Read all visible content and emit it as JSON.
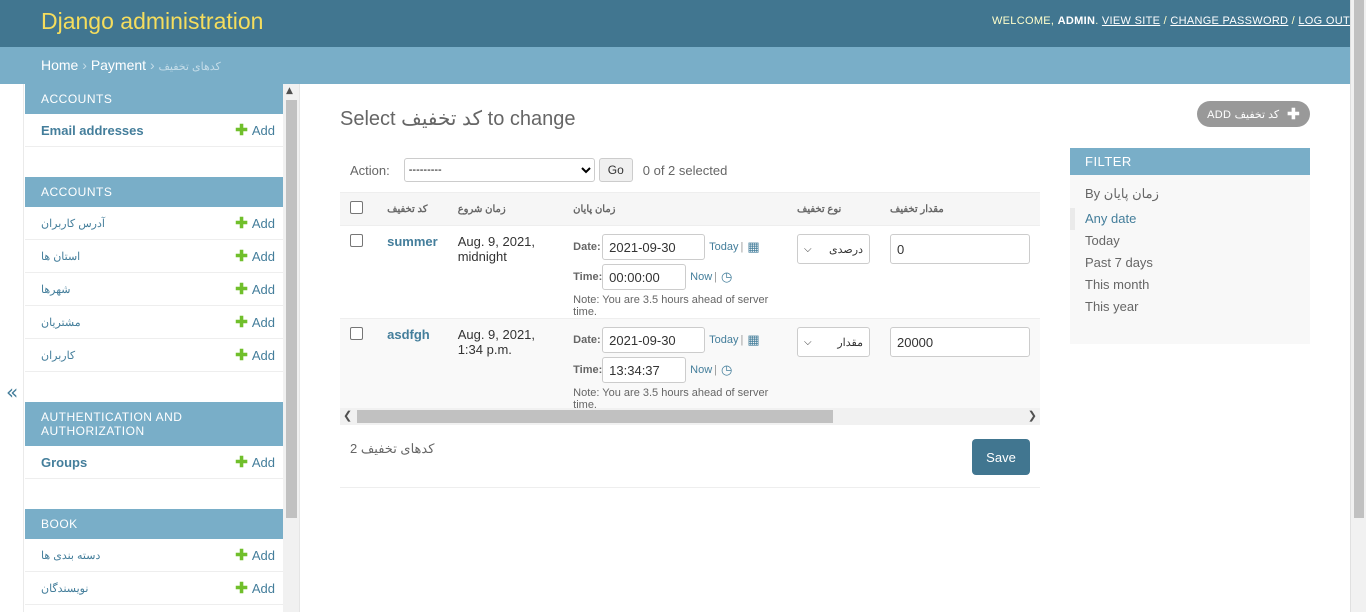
{
  "header": {
    "brand": "Django administration",
    "welcome": "WELCOME,",
    "user": "ADMIN",
    "dot": ".",
    "view_site": "VIEW SITE",
    "sep": "/",
    "change_password": "CHANGE PASSWORD",
    "log_out": "LOG OUT"
  },
  "breadcrumbs": {
    "home": "Home",
    "sep": "›",
    "app": "Payment",
    "current": "کدهای تخفیف"
  },
  "sidebar": {
    "toggle": "«",
    "add_label": "Add",
    "modules": [
      {
        "caption": "ACCOUNTS",
        "items": [
          "Email addresses"
        ]
      },
      {
        "caption": "ACCOUNTS",
        "items": [
          "آدرس کاربران",
          "استان ها",
          "شهرها",
          "مشتریان",
          "کاربران"
        ]
      },
      {
        "caption": "AUTHENTICATION AND AUTHORIZATION",
        "items": [
          "Groups"
        ]
      },
      {
        "caption": "BOOK",
        "items": [
          "دسته بندی ها",
          "نویسندگان"
        ]
      }
    ]
  },
  "content": {
    "title": "Select کد تخفیف to change",
    "add_button": "ADD کد تخفیف",
    "action_label": "Action:",
    "action_select": "---------",
    "go": "Go",
    "selected": "0 of 2 selected",
    "columns": [
      "کد تخفیف",
      "زمان شروع",
      "زمان پایان",
      "نوع تخفیف",
      "مقدار تخفیف"
    ],
    "date_label": "Date:",
    "time_label": "Time:",
    "today": "Today",
    "now": "Now",
    "pipe": "|",
    "help": "Note: You are 3.5 hours ahead of server time.",
    "rows": [
      {
        "code": "summer",
        "start": "Aug. 9, 2021, midnight",
        "date": "2021-09-30",
        "time": "00:00:00",
        "type": "درصدی",
        "amount": "0"
      },
      {
        "code": "asdfgh",
        "start": "Aug. 9, 2021, 1:34 p.m.",
        "date": "2021-09-30",
        "time": "13:34:37",
        "type": "مقدار",
        "amount": "20000"
      }
    ],
    "count": "2 کدهای تخفیف",
    "save": "Save"
  },
  "filter": {
    "title": "FILTER",
    "by": "By زمان پایان",
    "options": [
      "Any date",
      "Today",
      "Past 7 days",
      "This month",
      "This year"
    ]
  },
  "icons": {
    "plus": "plus-icon",
    "calendar": "calendar-icon",
    "clock": "clock-icon"
  },
  "colors": {
    "header": "#417690",
    "breadcrumbs": "#79aec8",
    "brand": "#f5dd5d",
    "link": "#447e9b",
    "add_green": "#70bf2b"
  }
}
